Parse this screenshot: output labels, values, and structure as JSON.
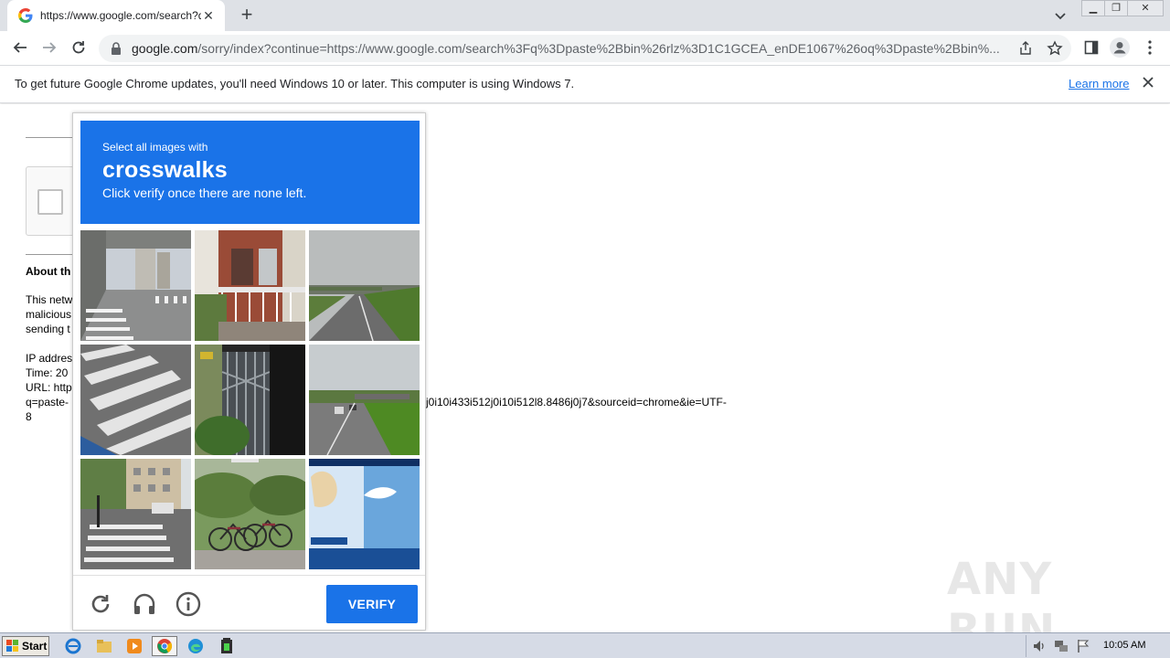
{
  "browser": {
    "tab_title": "https://www.google.com/search?q=",
    "url_host": "google.com",
    "url_rest": "/sorry/index?continue=https://www.google.com/search%3Fq%3Dpaste%2Bbin%26rlz%3D1C1GCEA_enDE1067%26oq%3Dpaste%2Bbin%...",
    "infobar_message": "To get future Google Chrome updates, you'll need Windows 10 or later. This computer is using Windows 7.",
    "infobar_link": "Learn more"
  },
  "page": {
    "about_heading": "About th",
    "para_1": "This netw",
    "para_2": "malicious",
    "para_3": "sending t",
    "ip_label": "IP addres",
    "time_label": "Time: 20",
    "url_label": "URL: http",
    "url_line_2_left": "q=paste-",
    "url_line_2_right": "j0i10i433i512j0i10i512l8.8486j0j7&sourceid=chrome&ie=UTF-",
    "url_line_3": "8"
  },
  "captcha": {
    "instruction_line_1": "Select all images with",
    "target_word": "crosswalks",
    "instruction_line_3": "Click verify once there are none left.",
    "verify_label": "VERIFY",
    "accent_color": "#1a73e8",
    "tiles": [
      {
        "id": 1,
        "subject": "elevated road with crosswalk"
      },
      {
        "id": 2,
        "subject": "brick building balcony"
      },
      {
        "id": 3,
        "subject": "rural road with overpass"
      },
      {
        "id": 4,
        "subject": "crosswalk stripes close up"
      },
      {
        "id": 5,
        "subject": "metal gate"
      },
      {
        "id": 6,
        "subject": "highway with cars"
      },
      {
        "id": 7,
        "subject": "street crosswalk with buildings"
      },
      {
        "id": 8,
        "subject": "bicycles in bushes"
      },
      {
        "id": 9,
        "subject": "delivery truck side"
      }
    ]
  },
  "watermark": "ANY RUN",
  "taskbar": {
    "start_label": "Start",
    "clock": "10:05 AM"
  }
}
